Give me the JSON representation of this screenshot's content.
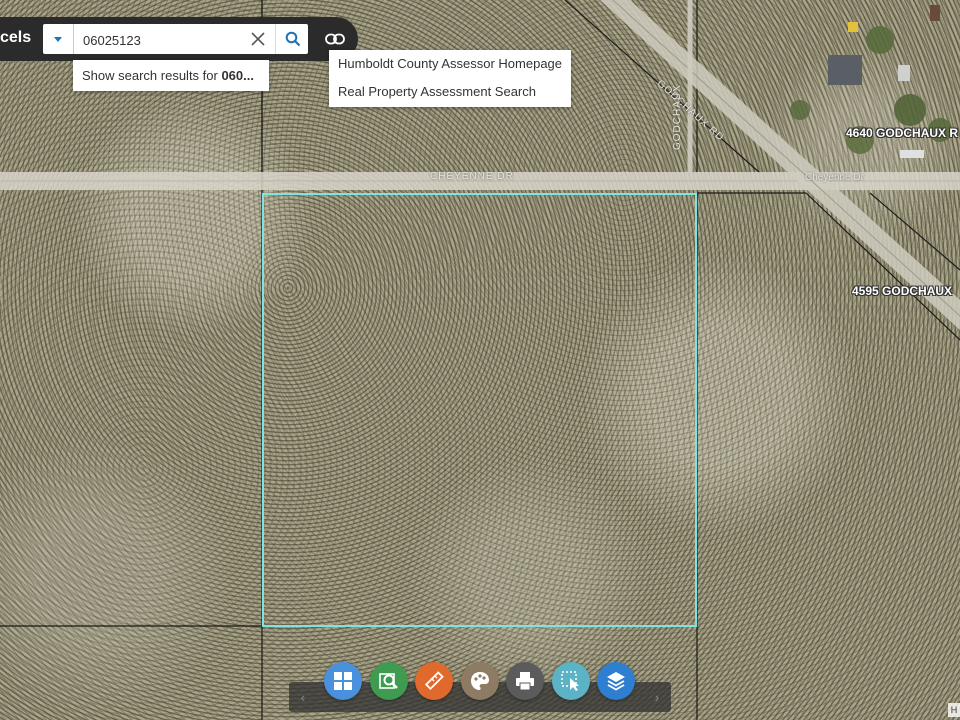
{
  "widget": {
    "title": "cels"
  },
  "search": {
    "value": "06025123",
    "clear_icon": "close-icon",
    "search_icon": "search-icon"
  },
  "suggestion": {
    "prefix": "Show search results for ",
    "term": "060..."
  },
  "links_menu": {
    "items": [
      {
        "label": "Humboldt County Assessor Homepage"
      },
      {
        "label": "Real Property Assessment Search"
      }
    ]
  },
  "map": {
    "road_labels": {
      "cheyenne_dr_upper": "CHEYENNE DR",
      "cheyenne_dr_mixed": "Cheyenne Dr",
      "godchaux_rd": "GODCHAUX RD",
      "side_rd": "GODCHAUX"
    },
    "address_labels": {
      "addr_4640": "4640 GODCHAUX R",
      "addr_4595": "4595 GODCHAUX"
    },
    "parcel_color": "#7fe3e0"
  },
  "toolbar": {
    "tools": [
      {
        "name": "basemap-gallery",
        "icon": "grid-icon",
        "color": "#4b90dc"
      },
      {
        "name": "query",
        "icon": "map-search-icon",
        "color": "#3e9b4f"
      },
      {
        "name": "measurement",
        "icon": "ruler-icon",
        "color": "#e06a2e"
      },
      {
        "name": "draw",
        "icon": "palette-icon",
        "color": "#8d7b63"
      },
      {
        "name": "print",
        "icon": "printer-icon",
        "color": "#5b5b5b"
      },
      {
        "name": "select",
        "icon": "select-icon",
        "color": "#5db3c6"
      },
      {
        "name": "layer-list",
        "icon": "layers-icon",
        "color": "#2f7fd1"
      }
    ],
    "prev_icon": "chevron-left-icon",
    "next_icon": "chevron-right-icon"
  },
  "attribution": {
    "label": "H"
  }
}
